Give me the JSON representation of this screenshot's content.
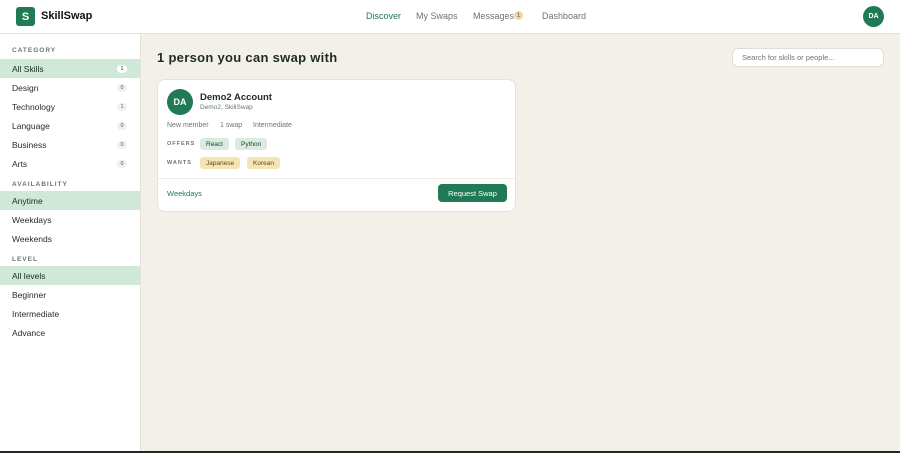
{
  "app": {
    "logo_letter": "S",
    "name": "SkillSwap"
  },
  "nav": {
    "discover": "Discover",
    "my_swaps": "My Swaps",
    "messages": "Messages",
    "messages_count": "1",
    "dashboard": "Dashboard"
  },
  "user": {
    "initials": "DA"
  },
  "sidebar": {
    "category_title": "CATEGORY",
    "categories": [
      {
        "label": "All Skills",
        "count": "1"
      },
      {
        "label": "Design",
        "count": "0"
      },
      {
        "label": "Technology",
        "count": "1"
      },
      {
        "label": "Language",
        "count": "0"
      },
      {
        "label": "Business",
        "count": "0"
      },
      {
        "label": "Arts",
        "count": "0"
      }
    ],
    "availability_title": "AVAILABILITY",
    "availability": [
      "Anytime",
      "Weekdays",
      "Weekends"
    ],
    "level_title": "LEVEL",
    "levels": [
      "All levels",
      "Beginner",
      "Intermediate",
      "Advance"
    ]
  },
  "main": {
    "heading": "1 person you can swap with",
    "search_placeholder": "Search for skills or people..."
  },
  "card": {
    "initials": "DA",
    "name": "Demo2 Account",
    "subtitle": "Demo2, SkillSwap",
    "member_status": "New member",
    "swaps": "1 swap",
    "level": "Intermediate",
    "offers_label": "OFFERS",
    "offers": [
      "React",
      "Python"
    ],
    "wants_label": "WANTS",
    "wants": [
      "Japanese",
      "Korean"
    ],
    "availability": "Weekdays",
    "request_label": "Request Swap"
  },
  "colors": {
    "accent": "#1f7a55",
    "selected": "#cfe8d8",
    "background": "#f3f0ea"
  }
}
